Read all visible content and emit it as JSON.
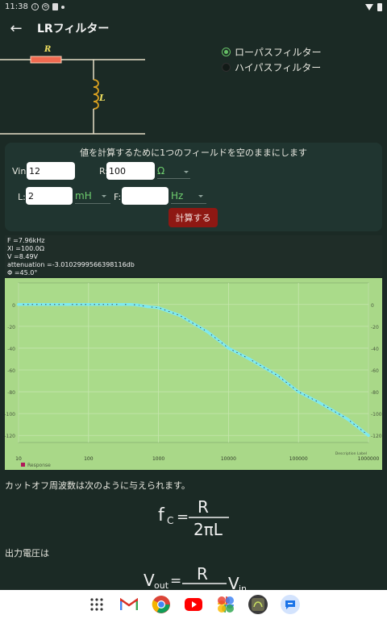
{
  "status_bar": {
    "time": "11:38"
  },
  "app_bar": {
    "title": "LRフィルター"
  },
  "circuit": {
    "r_label": "R",
    "l_label": "L"
  },
  "filter_options": [
    {
      "label": "ローパスフィルター",
      "selected": true
    },
    {
      "label": "ハイパスフィルター",
      "selected": false
    }
  ],
  "form": {
    "hint": "値を計算するために1つのフィールドを空のままにします",
    "vin_label": "Vin:",
    "vin_value": "12",
    "r_label": "R:",
    "r_value": "100",
    "r_unit": "Ω",
    "l_label": "L:",
    "l_value": "2",
    "l_unit": "mH",
    "f_label": "F:",
    "f_value": "",
    "f_unit": "Hz",
    "calculate_label": "計算する"
  },
  "results": {
    "f": "F =7.96kHz",
    "xl": "Xl =100.0Ω",
    "v": "V =8.49V",
    "attenuation": "attenuation =-3.0102999566398116db",
    "phi": "Φ =45.0°"
  },
  "chart_data": {
    "type": "line",
    "x_scale": "log",
    "xlim": [
      10,
      1000000
    ],
    "ylim": [
      -125,
      5
    ],
    "x_ticks": [
      "10",
      "100",
      "1000",
      "10000",
      "100000",
      "1000000"
    ],
    "y_ticks": [
      "0",
      "-20",
      "-40",
      "-60",
      "-80",
      "-100",
      "-120"
    ],
    "x_axis_label": "Description Label",
    "legend": "Response",
    "legend_position": "bottom-left",
    "series_color": "#7fe9ef",
    "series": [
      {
        "name": "Response",
        "x": [
          10,
          20,
          50,
          100,
          200,
          300,
          400,
          500,
          700,
          1000,
          2000,
          5000,
          10000,
          20000,
          50000,
          100000,
          200000,
          500000,
          1000000
        ],
        "y": [
          0,
          0,
          0,
          0,
          0,
          0,
          0,
          -0.5,
          -2,
          -3,
          -10,
          -25,
          -40,
          -50,
          -65,
          -80,
          -90,
          -105,
          -120
        ]
      }
    ]
  },
  "explain": {
    "cutoff_text": "カットオフ周波数は次のように与えられます。",
    "fc_lhs": "f",
    "fc_sub": "C",
    "fc_num": "R",
    "fc_den": "2πL",
    "vout_text": "出力電圧は",
    "vout_lhs": "V",
    "vout_sub": "out",
    "vout_num": "R",
    "vout_vin": "V",
    "vout_vin_sub": "in"
  },
  "nav_apps": [
    "apps-icon",
    "gmail-icon",
    "chrome-icon",
    "youtube-icon",
    "photos-icon",
    "lr-filter-app-icon",
    "messages-icon"
  ]
}
